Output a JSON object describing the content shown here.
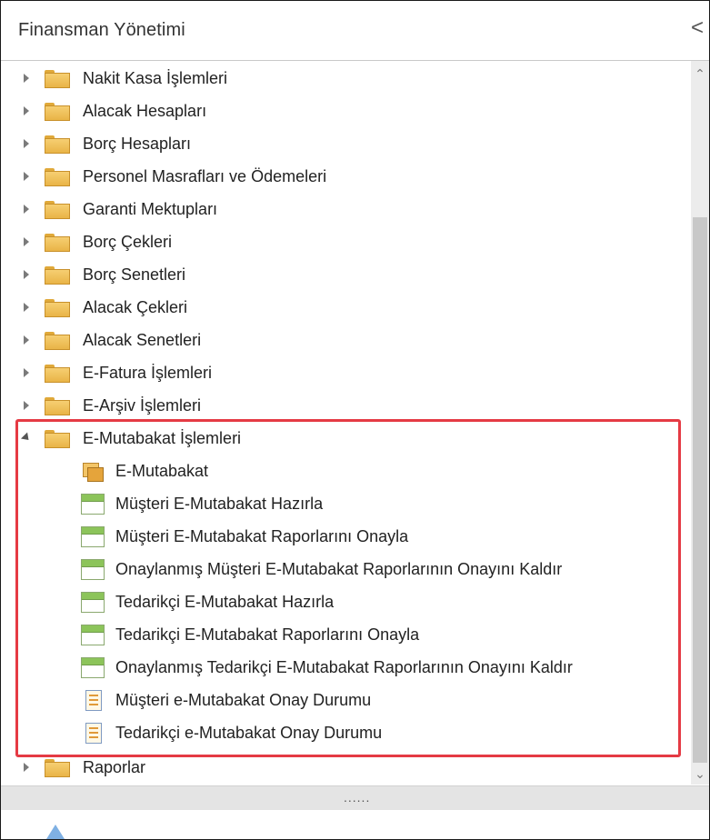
{
  "panel": {
    "title": "Finansman Yönetimi",
    "collapse_glyph": "<"
  },
  "tree": {
    "folders": [
      {
        "label": "Nakit Kasa İşlemleri"
      },
      {
        "label": "Alacak Hesapları"
      },
      {
        "label": "Borç Hesapları"
      },
      {
        "label": "Personel Masrafları ve Ödemeleri"
      },
      {
        "label": "Garanti Mektupları"
      },
      {
        "label": "Borç Çekleri"
      },
      {
        "label": "Borç Senetleri"
      },
      {
        "label": "Alacak Çekleri"
      },
      {
        "label": "Alacak Senetleri"
      },
      {
        "label": "E-Fatura İşlemleri"
      },
      {
        "label": "E-Arşiv İşlemleri"
      },
      {
        "label": "E-Mutabakat İşlemleri",
        "expanded": true
      }
    ],
    "children": [
      {
        "label": "E-Mutabakat",
        "icon": "stack-icon"
      },
      {
        "label": "Müşteri E-Mutabakat Hazırla",
        "icon": "form-icon"
      },
      {
        "label": "Müşteri E-Mutabakat Raporlarını Onayla",
        "icon": "form-icon"
      },
      {
        "label": "Onaylanmış Müşteri E-Mutabakat Raporlarının Onayını Kaldır",
        "icon": "form-icon"
      },
      {
        "label": "Tedarikçi E-Mutabakat Hazırla",
        "icon": "form-icon"
      },
      {
        "label": "Tedarikçi E-Mutabakat Raporlarını Onayla",
        "icon": "form-icon"
      },
      {
        "label": "Onaylanmış Tedarikçi E-Mutabakat Raporlarının Onayını Kaldır",
        "icon": "form-icon"
      },
      {
        "label": "Müşteri e-Mutabakat Onay Durumu",
        "icon": "report-icon"
      },
      {
        "label": "Tedarikçi e-Mutabakat Onay Durumu",
        "icon": "report-icon"
      }
    ],
    "after": [
      {
        "label": "Raporlar"
      }
    ]
  },
  "splitter": {
    "grip": "......"
  },
  "colors": {
    "highlight": "#e53a44",
    "folder": "#f0c15a",
    "form_bar": "#8cc45a"
  }
}
